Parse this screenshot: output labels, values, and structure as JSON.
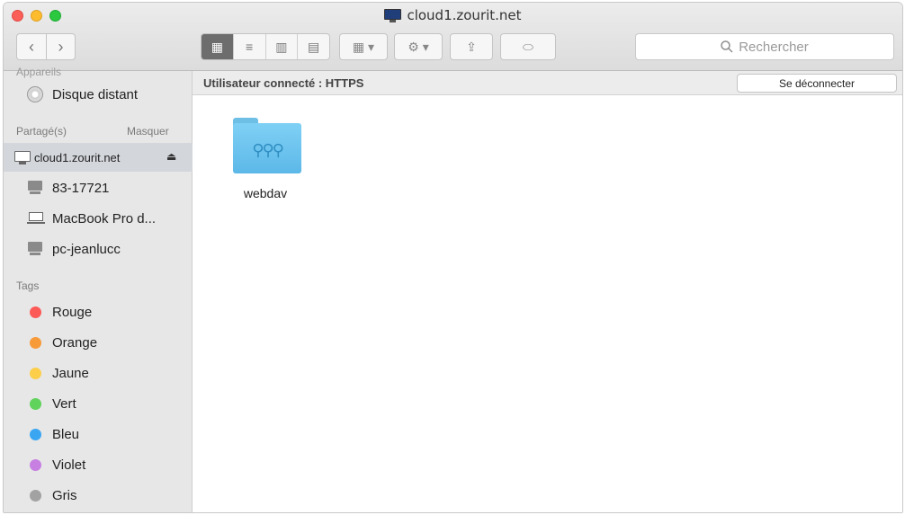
{
  "window": {
    "title": "cloud1.zourit.net"
  },
  "toolbar": {
    "back": "‹",
    "forward": "›",
    "views": [
      "▦",
      "≡",
      "▥",
      "▤"
    ],
    "arrange": "▦ ▾",
    "action": "⚙ ▾",
    "share": "⇪",
    "tag": "⬭"
  },
  "search": {
    "placeholder": "Rechercher",
    "icon": "search-icon"
  },
  "sidebar": {
    "partial_header": "Appareils",
    "remote_disc": "Disque distant",
    "shared_header": "Partagé(s)",
    "shared_hide": "Masquer",
    "shared_items": [
      {
        "label": "cloud1.zourit.net",
        "icon": "monitor-icon"
      },
      {
        "label": "83-17721",
        "icon": "pc-icon"
      },
      {
        "label": "MacBook Pro d...",
        "icon": "laptop-icon"
      },
      {
        "label": "pc-jeanlucc",
        "icon": "pc-icon"
      }
    ],
    "eject": "⏏",
    "tags_header": "Tags",
    "tags": [
      {
        "label": "Rouge",
        "color": "#fc5a57"
      },
      {
        "label": "Orange",
        "color": "#f79a3a"
      },
      {
        "label": "Jaune",
        "color": "#fcce4a"
      },
      {
        "label": "Vert",
        "color": "#5fd35b"
      },
      {
        "label": "Bleu",
        "color": "#3aa6f2"
      },
      {
        "label": "Violet",
        "color": "#c77fe2"
      },
      {
        "label": "Gris",
        "color": "#a2a2a2"
      }
    ]
  },
  "pathbar": {
    "user": "Utilisateur connecté : HTTPS",
    "disconnect": "Se déconnecter"
  },
  "content": {
    "items": [
      {
        "name": "webdav",
        "icon": "shared-folder-icon"
      }
    ]
  }
}
